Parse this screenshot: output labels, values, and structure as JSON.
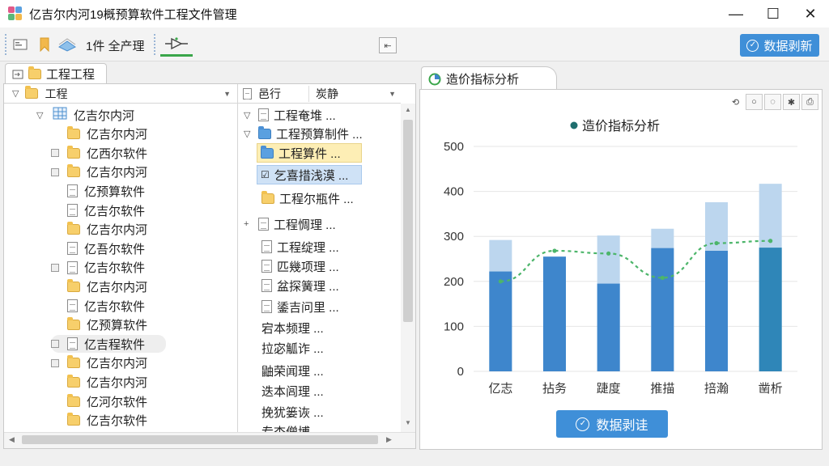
{
  "window": {
    "title": "亿吉尔内河19概预算软件工程文件管理",
    "minimize": "—",
    "maximize": "☐",
    "close": "✕"
  },
  "toolbar": {
    "label": "1件 全产理",
    "collapse_glyph": "⇤",
    "primary_button": "数据剥新"
  },
  "left_tab": {
    "label": "工程工程"
  },
  "tree_header": {
    "label": "工程"
  },
  "list_header": {
    "col1": "邑行",
    "col2": "炭静"
  },
  "tree_items": [
    {
      "label": "亿吉尔内河",
      "icon": "grid",
      "expander": "▽"
    },
    {
      "label": "亿吉尔内河",
      "icon": "folder"
    },
    {
      "label": "亿西尔软件",
      "icon": "folder",
      "expander": "-"
    },
    {
      "label": "亿吉尔内河",
      "icon": "folder",
      "expander": "-"
    },
    {
      "label": "亿预算软件",
      "icon": "doc"
    },
    {
      "label": "亿吉尔软件",
      "icon": "doc"
    },
    {
      "label": "亿吉尔内河",
      "icon": "folder"
    },
    {
      "label": "亿吾尔软件",
      "icon": "doc"
    },
    {
      "label": "亿吉尔软件",
      "icon": "doc",
      "expander": "-"
    },
    {
      "label": "亿吉尔内河",
      "icon": "folder"
    },
    {
      "label": "亿吉尔软件",
      "icon": "doc"
    },
    {
      "label": "亿预算软件",
      "icon": "folder"
    },
    {
      "label": "亿吉程软件",
      "icon": "doc",
      "expander": "-"
    },
    {
      "label": "亿吉尔内河",
      "icon": "folder",
      "expander": "-"
    },
    {
      "label": "亿吉尔内河",
      "icon": "folder"
    },
    {
      "label": "亿河尔软件",
      "icon": "folder"
    },
    {
      "label": "亿吉尔软件",
      "icon": "folder"
    }
  ],
  "list_items": [
    {
      "label": "工程奄堆 ...",
      "icon": "doc",
      "expander": "▽"
    },
    {
      "label": "工程预算制件 ...",
      "icon": "folder-blue",
      "expander": "▽"
    },
    {
      "label": "工程算件 ...",
      "icon": "folder-blue"
    },
    {
      "label": "乞喜措浅漠 ...",
      "icon": "check"
    },
    {
      "label": "工程尔瓶件 ...",
      "icon": "folder"
    },
    {
      "label": "工程惆理 ...",
      "icon": "doc",
      "expander": "+"
    },
    {
      "label": "工程绽理 ...",
      "icon": "doc"
    },
    {
      "label": "匹幾项理 ...",
      "icon": "doc"
    },
    {
      "label": "盆探簧理 ...",
      "icon": "doc"
    },
    {
      "label": "鋈吉问里 ...",
      "icon": "doc"
    },
    {
      "label": "宕本频理 ...",
      "icon": "none"
    },
    {
      "label": "拉宓觚诈 ...",
      "icon": "none"
    },
    {
      "label": "鼬荣闻理 ...",
      "icon": "none"
    },
    {
      "label": "迭本闾理 ...",
      "icon": "none"
    },
    {
      "label": "挽犹篓诙 ...",
      "icon": "none"
    },
    {
      "label": "专杏僧博 ...",
      "icon": "none"
    }
  ],
  "right_tab": {
    "label": "造价指标分析"
  },
  "chart_tools": [
    "⟲",
    "○",
    "◌",
    "✱",
    "⎙"
  ],
  "bottom_button": {
    "label": "数据剥诖"
  },
  "colors": {
    "bar_dark": "#3e86cc",
    "bar_light": "#bcd6ee",
    "bar_teal": "#2f86b8",
    "trend": "#4cb56a",
    "primary": "#3f8fd8"
  },
  "chart_data": {
    "type": "bar",
    "title": "造价指标分析",
    "legend": [
      {
        "name": "造价指标分析",
        "color": "#1e6e6e"
      }
    ],
    "legend_position": "top-center",
    "categories": [
      "亿志",
      "拈务",
      "踕度",
      "推描",
      "掊瀚",
      "凿析"
    ],
    "series": [
      {
        "values": [
          222,
          255,
          195,
          274,
          268,
          275
        ],
        "stacked": true
      },
      {
        "values": [
          70,
          -13,
          107,
          43,
          108,
          142
        ],
        "stacked": true
      },
      {
        "values": [
          200,
          268,
          262,
          208,
          285,
          290
        ],
        "kind": "line",
        "style": "dashed"
      }
    ],
    "ylim": [
      0,
      500
    ],
    "yticks": [
      0,
      100,
      200,
      300,
      400,
      500
    ],
    "grid": true
  }
}
